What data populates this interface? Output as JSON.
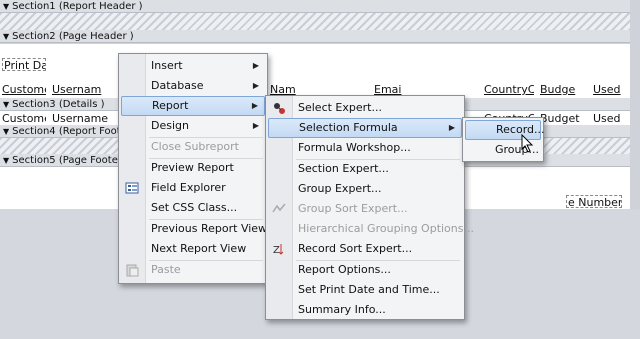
{
  "sections": [
    {
      "label": "Section1 (Report Header  )"
    },
    {
      "label": "Section2 (Page Header  )"
    },
    {
      "label": "Section3 (Details  )"
    },
    {
      "label": "Section4 (Report Footer"
    },
    {
      "label": "Section5 (Page Footer  )"
    }
  ],
  "fields": {
    "print_date": "Print Dat",
    "customer_hdr": "Custome",
    "username_hdr": "Usernam",
    "name_hdr": "Nam",
    "email_hdr": "Emai",
    "country_hdr": "CountryC",
    "budget_hdr": "Budge",
    "used_hdr": "Used",
    "customer_det": "Custome",
    "username_det": "Username",
    "country_det": "CountryC",
    "budget_det": "Budget",
    "used_det": "Used",
    "page_number": "e Number"
  },
  "menu1": {
    "items": [
      {
        "label": "Insert",
        "submenu": true
      },
      {
        "label": "Database",
        "submenu": true
      },
      {
        "label": "Report",
        "submenu": true,
        "highlighted": true
      },
      {
        "label": "Design",
        "submenu": true
      },
      {
        "label": "Close Subreport",
        "disabled": true
      },
      {
        "label": "Preview Report"
      },
      {
        "label": "Field Explorer",
        "icon": "field-explorer-icon"
      },
      {
        "label": "Set CSS Class..."
      },
      {
        "label": "Previous Report View"
      },
      {
        "label": "Next Report View"
      },
      {
        "label": "Paste",
        "disabled": true,
        "icon": "paste-icon"
      }
    ]
  },
  "menu2": {
    "items": [
      {
        "label": "Select Expert...",
        "icon": "select-expert-icon"
      },
      {
        "label": "Selection Formula",
        "submenu": true,
        "highlighted": true
      },
      {
        "label": "Formula Workshop..."
      },
      {
        "label": "Section Expert..."
      },
      {
        "label": "Group Expert..."
      },
      {
        "label": "Group Sort Expert...",
        "disabled": true,
        "icon": "group-sort-icon"
      },
      {
        "label": "Hierarchical Grouping Options...",
        "disabled": true
      },
      {
        "label": "Record Sort Expert...",
        "icon": "record-sort-icon"
      },
      {
        "label": "Report Options..."
      },
      {
        "label": "Set Print Date and Time..."
      },
      {
        "label": "Summary Info..."
      }
    ]
  },
  "menu3": {
    "items": [
      {
        "label": "Record...",
        "highlighted": true
      },
      {
        "label": "Group..."
      }
    ]
  },
  "colors": {
    "highlight": "#c3daf4",
    "highlight_border": "#7ea6d6",
    "menu_bg": "#f3f4f6"
  }
}
